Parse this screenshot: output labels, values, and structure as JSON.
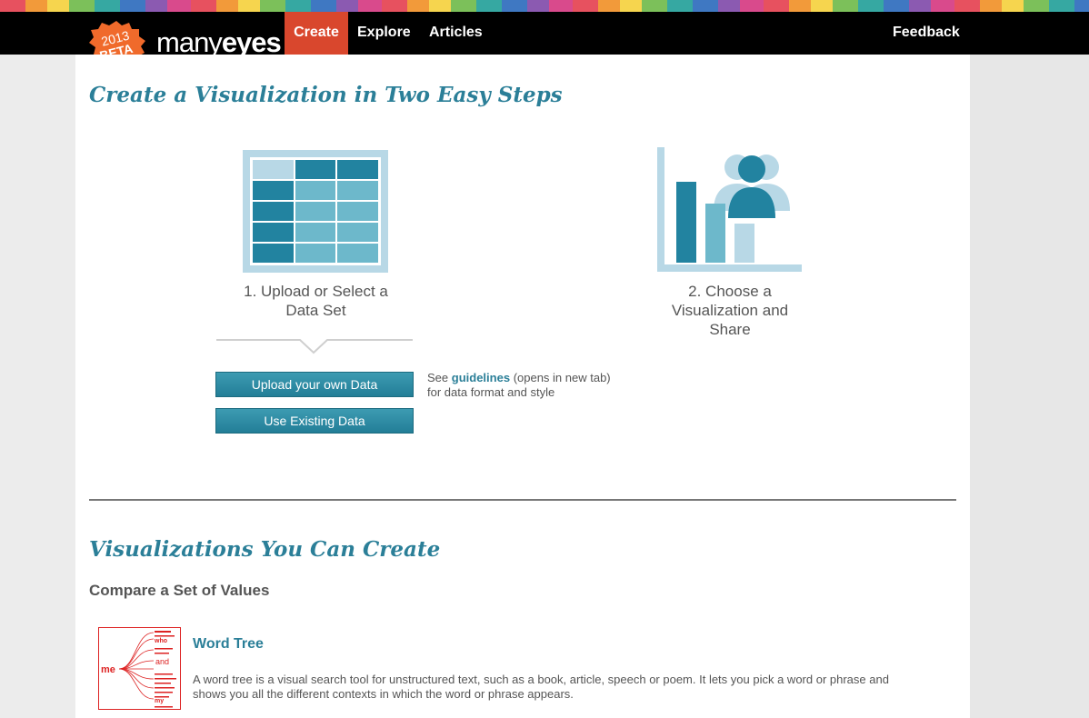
{
  "logo": {
    "badge_year": "2013",
    "badge_text": "BETA",
    "brand_light": "many",
    "brand_bold": "eyes"
  },
  "nav": {
    "create": "Create",
    "explore": "Explore",
    "articles": "Articles",
    "feedback": "Feedback"
  },
  "main_title": "Create a Visualization in Two Easy Steps",
  "steps": {
    "step1": "1. Upload or Select a Data Set",
    "step2": "2. Choose a Visualization and Share"
  },
  "buttons": {
    "upload": "Upload your own Data",
    "existing": "Use Existing Data"
  },
  "guidelines": {
    "prefix": "See",
    "link": "guidelines",
    "rest": "(opens in new tab)",
    "line2": "for data format and style"
  },
  "section_title": "Visualizations You Can Create",
  "compare_title": "Compare a Set of Values",
  "word_tree": {
    "title": "Word Tree",
    "description": "A word tree is a visual search tool for unstructured text, such as a book, article, speech or poem. It lets you pick a word or phrase and shows you all the different contexts in which the word or phrase appears.",
    "thumb_root": "me",
    "thumb_branch_1": "who",
    "thumb_branch_2": "and",
    "thumb_branch_3": "my"
  },
  "colors": {
    "accent": "#2b7f98",
    "nav_active": "#d9472d",
    "badge": "#f06a2b"
  }
}
